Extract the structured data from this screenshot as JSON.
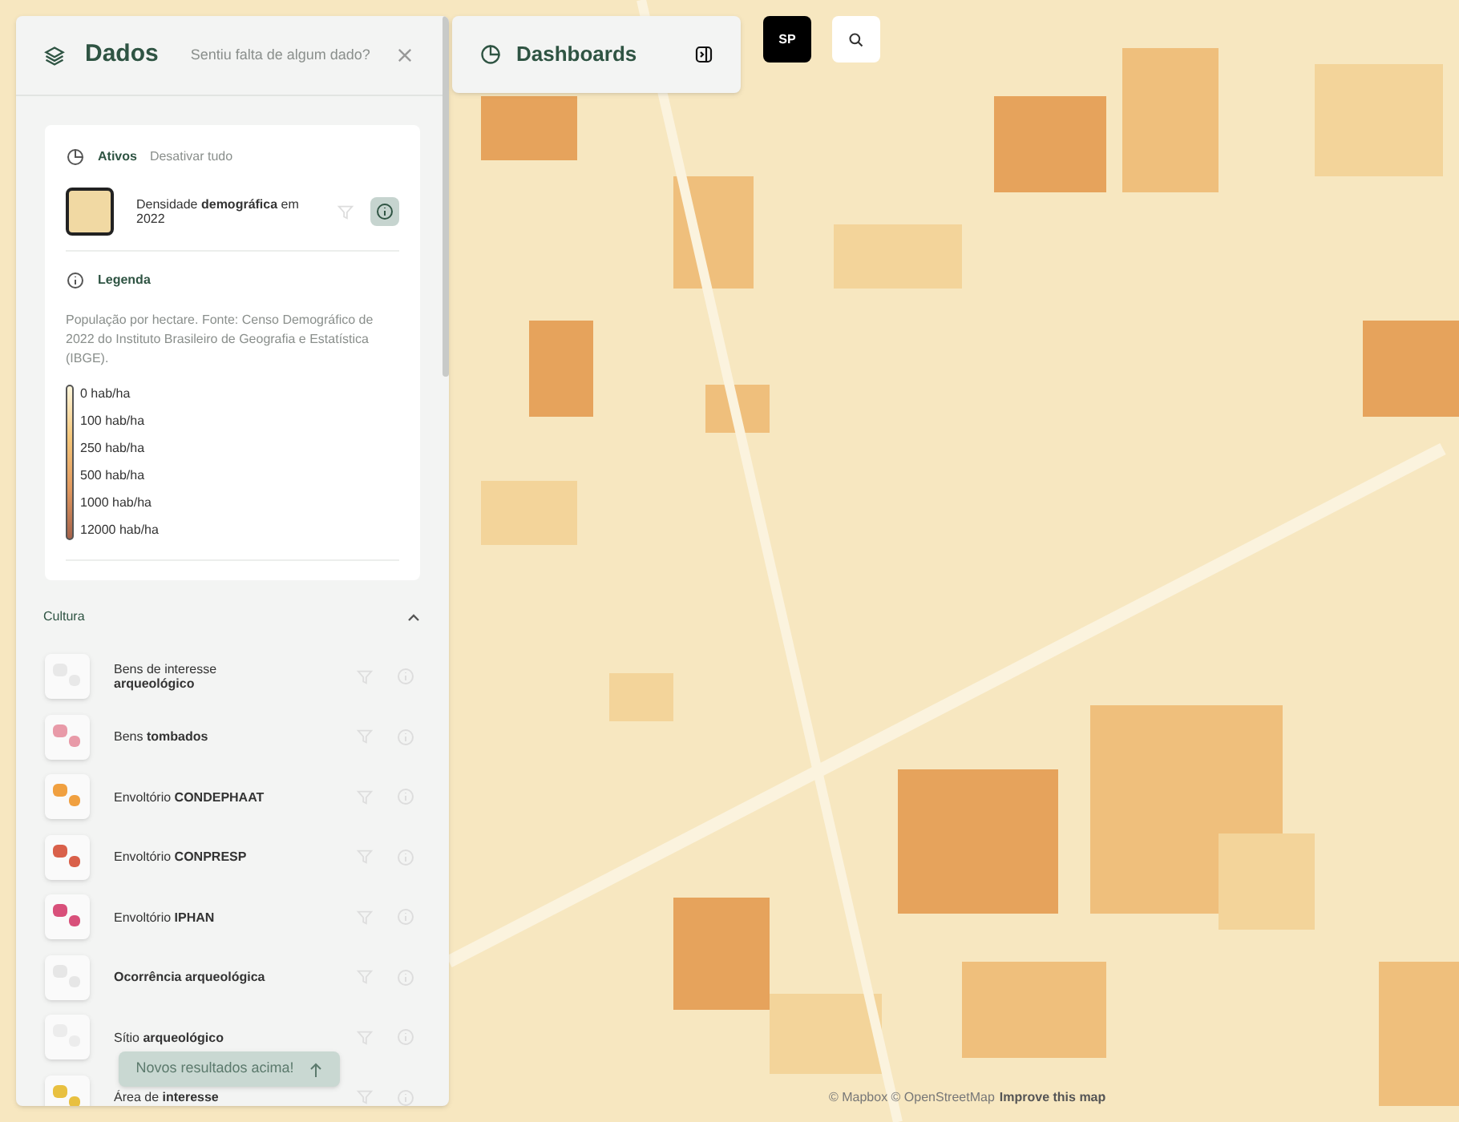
{
  "panel": {
    "title": "Dados",
    "prompt": "Sentiu falta de algum dado?"
  },
  "active": {
    "heading": "Ativos",
    "action": "Desativar tudo",
    "layers": [
      {
        "name": "Densidade **demográfica** em 2022",
        "info_selected": true
      }
    ]
  },
  "legend": {
    "heading": "Legenda",
    "description": "População por hectare. Fonte: Censo Demográfico de 2022 do Instituto Brasileiro de Geografia e Estatística (IBGE).",
    "stops": [
      "0 hab/ha",
      "100 hab/ha",
      "250 hab/ha",
      "500 hab/ha",
      "1000 hab/ha",
      "12000 hab/ha"
    ]
  },
  "section": {
    "title": "Cultura",
    "expanded": true,
    "layers": [
      {
        "name": "Bens de interesse **arqueológico**",
        "color": "#e8e8e8"
      },
      {
        "name": "Bens **tombados**",
        "color": "#e89aa8"
      },
      {
        "name": "Envoltório **CONDEPHAAT**",
        "color": "#f0a040"
      },
      {
        "name": "Envoltório **CONPRESP**",
        "color": "#d9604a"
      },
      {
        "name": "Envoltório **IPHAN**",
        "color": "#d8507a"
      },
      {
        "name": "**Ocorrência arqueológica**",
        "color": "#e6e6e6"
      },
      {
        "name": "Sítio **arqueológico**",
        "color": "#ececec"
      },
      {
        "name": "Área de **interesse**",
        "color": "#e8c040"
      }
    ]
  },
  "toast": {
    "label": "Novos resultados acima!"
  },
  "dashboards": {
    "title": "Dashboards"
  },
  "toolbar": {
    "city": "SP"
  },
  "attribution": {
    "text": "© Mapbox © OpenStreetMap",
    "link": "Improve this map"
  }
}
